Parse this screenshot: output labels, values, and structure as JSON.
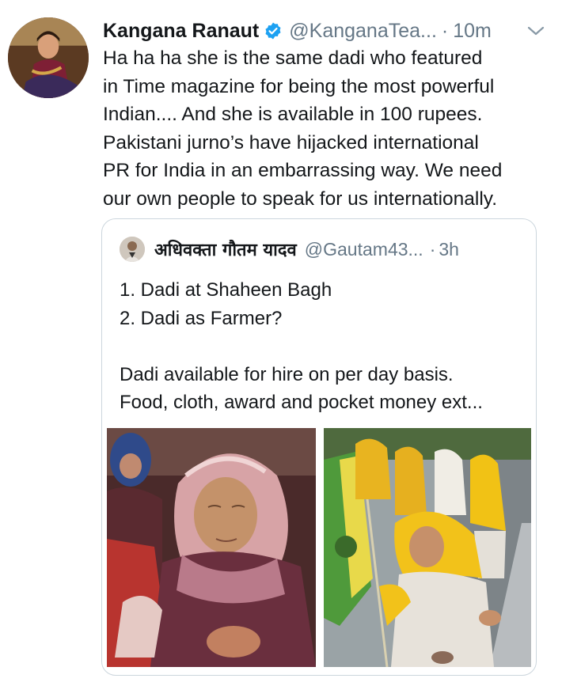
{
  "tweet": {
    "author_name": "Kangana Ranaut",
    "handle": "@KanganaTea...",
    "separator": "·",
    "time": "10m",
    "text_lines": [
      "Ha ha ha she is the same dadi who featured",
      "in Time magazine for being the most powerful",
      "Indian.... And she is available in 100 rupees.",
      "Pakistani jurno’s have hijacked international",
      "PR for India in an embarrassing way. We need",
      "our own people to speak for us internationally."
    ]
  },
  "quoted_tweet": {
    "author_name": "अधिवक्ता गौतम यादव",
    "handle": "@Gautam43...",
    "separator": "·",
    "time": "3h",
    "text_lines": [
      "1. Dadi at Shaheen Bagh",
      "2. Dadi as Farmer?",
      "",
      "Dadi available for hire on per day basis.",
      "Food, cloth, award and pocket money ext..."
    ]
  },
  "colors": {
    "text_primary": "#14171a",
    "text_secondary": "#657786",
    "verified_blue": "#1da1f2",
    "border": "#ccd6dd"
  },
  "icons": {
    "verified": "verified-badge-icon",
    "more": "chevron-down-icon"
  }
}
